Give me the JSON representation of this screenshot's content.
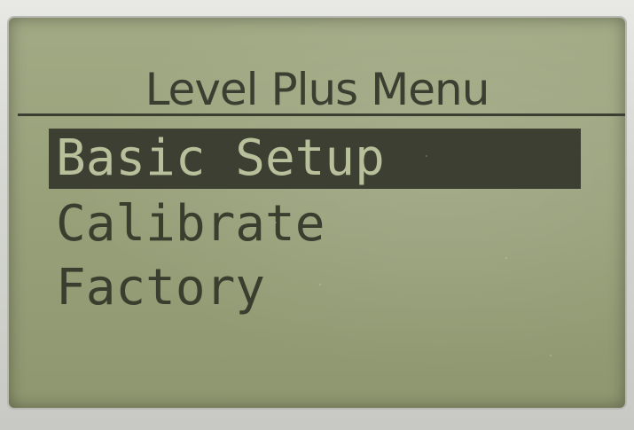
{
  "lcd": {
    "title": "Level Plus Menu",
    "menu_items": [
      {
        "label": "Basic Setup",
        "selected": true
      },
      {
        "label": "Calibrate",
        "selected": false
      },
      {
        "label": "Factory",
        "selected": false
      }
    ]
  },
  "colors": {
    "lcd_background": "#98a07a",
    "lcd_text": "#3b3e30",
    "highlight_background": "#3c3f31",
    "highlight_text": "#b8bf9b"
  }
}
